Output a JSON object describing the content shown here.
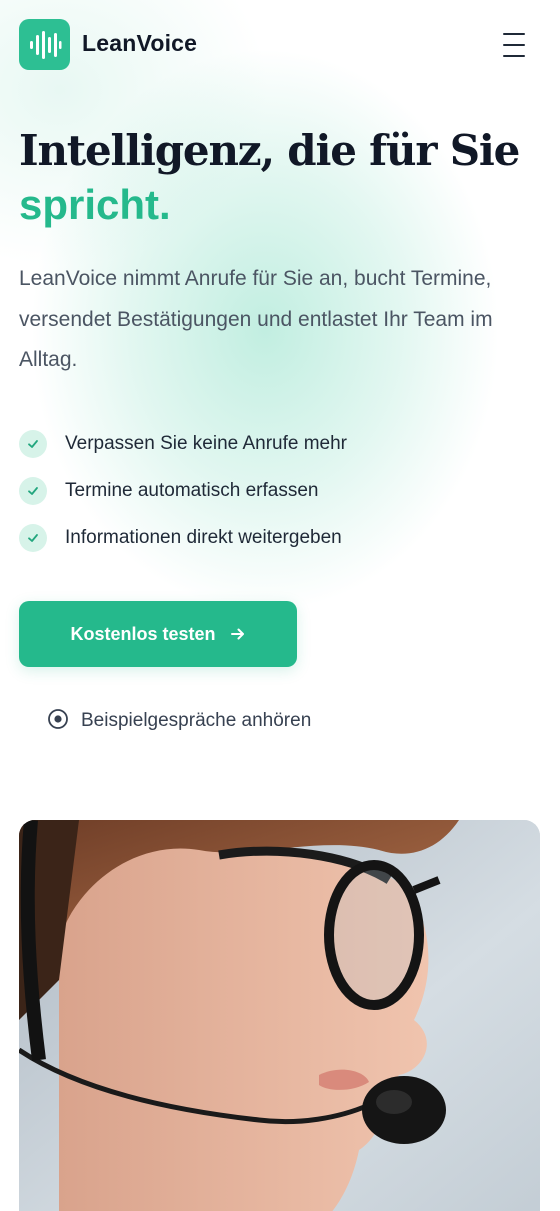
{
  "header": {
    "brand_name": "LeanVoice",
    "logo_icon": "soundwave-logo-icon",
    "menu_icon": "hamburger-menu-icon"
  },
  "hero": {
    "title_line": "Intelligenz, die für Sie",
    "title_accent": "spricht.",
    "lead": "LeanVoice nimmt Anrufe für Sie an, bucht Termine, versendet Bestätigungen und entlastet Ihr Team im Alltag."
  },
  "features": [
    {
      "icon": "check-icon",
      "label": "Verpassen Sie keine Anrufe mehr"
    },
    {
      "icon": "check-icon",
      "label": "Termine automatisch erfassen"
    },
    {
      "icon": "check-icon",
      "label": "Informationen direkt weitergeben"
    }
  ],
  "cta": {
    "label": "Kostenlos testen",
    "icon": "arrow-right-icon"
  },
  "secondary_link": {
    "label": "Beispielgespräche anhören",
    "icon": "play-circle-icon"
  },
  "image": {
    "subject": "woman-with-headset-photo"
  },
  "colors": {
    "brand": "#25b98c",
    "text_dark": "#111827",
    "text_muted": "#4b5563",
    "check_bg": "#d7f3e9"
  }
}
